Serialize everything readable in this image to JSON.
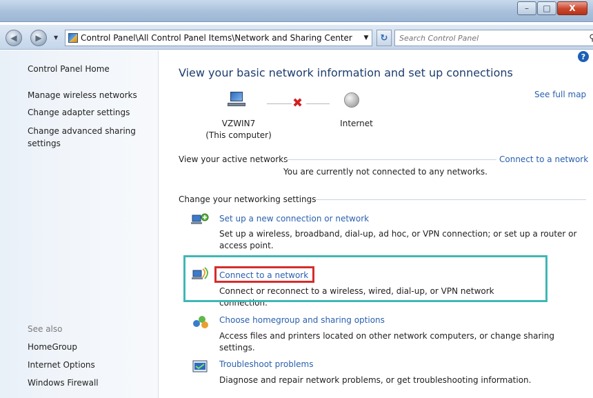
{
  "window": {
    "minimize_glyph": "–",
    "maximize_glyph": "□",
    "close_glyph": "X"
  },
  "nav": {
    "address": "Control Panel\\All Control Panel Items\\Network and Sharing Center",
    "search_placeholder": "Search Control Panel",
    "help_glyph": "?"
  },
  "sidebar": {
    "home": "Control Panel Home",
    "links": [
      "Manage wireless networks",
      "Change adapter settings",
      "Change advanced sharing settings"
    ],
    "see_also_label": "See also",
    "see_also": [
      "HomeGroup",
      "Internet Options",
      "Windows Firewall"
    ]
  },
  "main": {
    "title": "View your basic network information and set up connections",
    "see_full_map": "See full map",
    "computer_name": "VZWIN7",
    "computer_sub": "(This computer)",
    "internet_label": "Internet",
    "active_networks_label": "View your active networks",
    "connect_to_network_link": "Connect to a network",
    "not_connected_text": "You are currently not connected to any networks.",
    "change_settings_label": "Change your networking settings",
    "tasks": [
      {
        "link": "Set up a new connection or network",
        "desc": "Set up a wireless, broadband, dial-up, ad hoc, or VPN connection; or set up a router or access point.",
        "icon": "new-connection-icon"
      },
      {
        "link": "Connect to a network",
        "desc": "Connect or reconnect to a wireless, wired, dial-up, or VPN network connection.",
        "icon": "connect-network-icon"
      },
      {
        "link": "Choose homegroup and sharing options",
        "desc": "Access files and printers located on other network computers, or change sharing settings.",
        "icon": "homegroup-icon"
      },
      {
        "link": "Troubleshoot problems",
        "desc": "Diagnose and repair network problems, or get troubleshooting information.",
        "icon": "troubleshoot-icon"
      }
    ]
  },
  "colors": {
    "link": "#2a60b0",
    "title": "#1c3c6e",
    "highlight_teal": "#3fb7b4",
    "highlight_red": "#d62c2c",
    "disconnected_x": "#d32020"
  }
}
